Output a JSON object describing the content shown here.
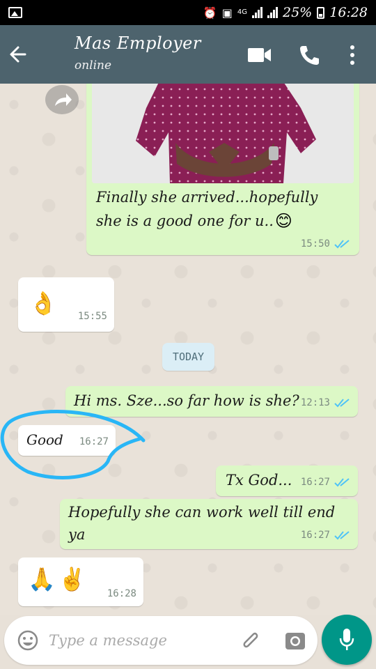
{
  "status_bar": {
    "network": "4G",
    "battery": "25%",
    "time": "16:28"
  },
  "header": {
    "contact_name": "Mas Employer",
    "status": "online"
  },
  "messages": [
    {
      "direction": "out",
      "type": "image",
      "text_line1": "Finally she arrived...hopefully",
      "text_line2": "she is a good one for u..",
      "emoji": "😊",
      "time": "15:50",
      "read": true
    },
    {
      "direction": "in",
      "emoji": "👌",
      "time": "15:55"
    },
    {
      "direction": "out",
      "text": "Hi ms. Sze...so far how is she?",
      "time": "12:13",
      "read": true
    },
    {
      "direction": "in",
      "text": "Good",
      "time": "16:27"
    },
    {
      "direction": "out",
      "text": "Tx God...",
      "time": "16:27",
      "read": true
    },
    {
      "direction": "out",
      "text_line1": "Hopefully she can work well till end",
      "text_line2": "ya",
      "time": "16:27",
      "read": true
    },
    {
      "direction": "in",
      "emoji": "🙏✌️",
      "time": "16:28"
    }
  ],
  "date_divider": "TODAY",
  "composer": {
    "placeholder": "Type a message"
  },
  "colors": {
    "header": "#4d636d",
    "outgoing_bubble": "#dcf8c6",
    "incoming_bubble": "#ffffff",
    "read_ticks": "#4fc3f7",
    "mic_button": "#009688",
    "annotation_circle": "#29b6f6"
  },
  "icons": [
    "image-icon",
    "alarm-icon",
    "vibrate-icon",
    "signal-icon",
    "battery-icon",
    "back-arrow-icon",
    "video-call-icon",
    "phone-call-icon",
    "more-vert-icon",
    "forward-icon",
    "read-receipt-icon",
    "emoji-icon",
    "attach-clip-icon",
    "camera-icon",
    "mic-icon"
  ]
}
